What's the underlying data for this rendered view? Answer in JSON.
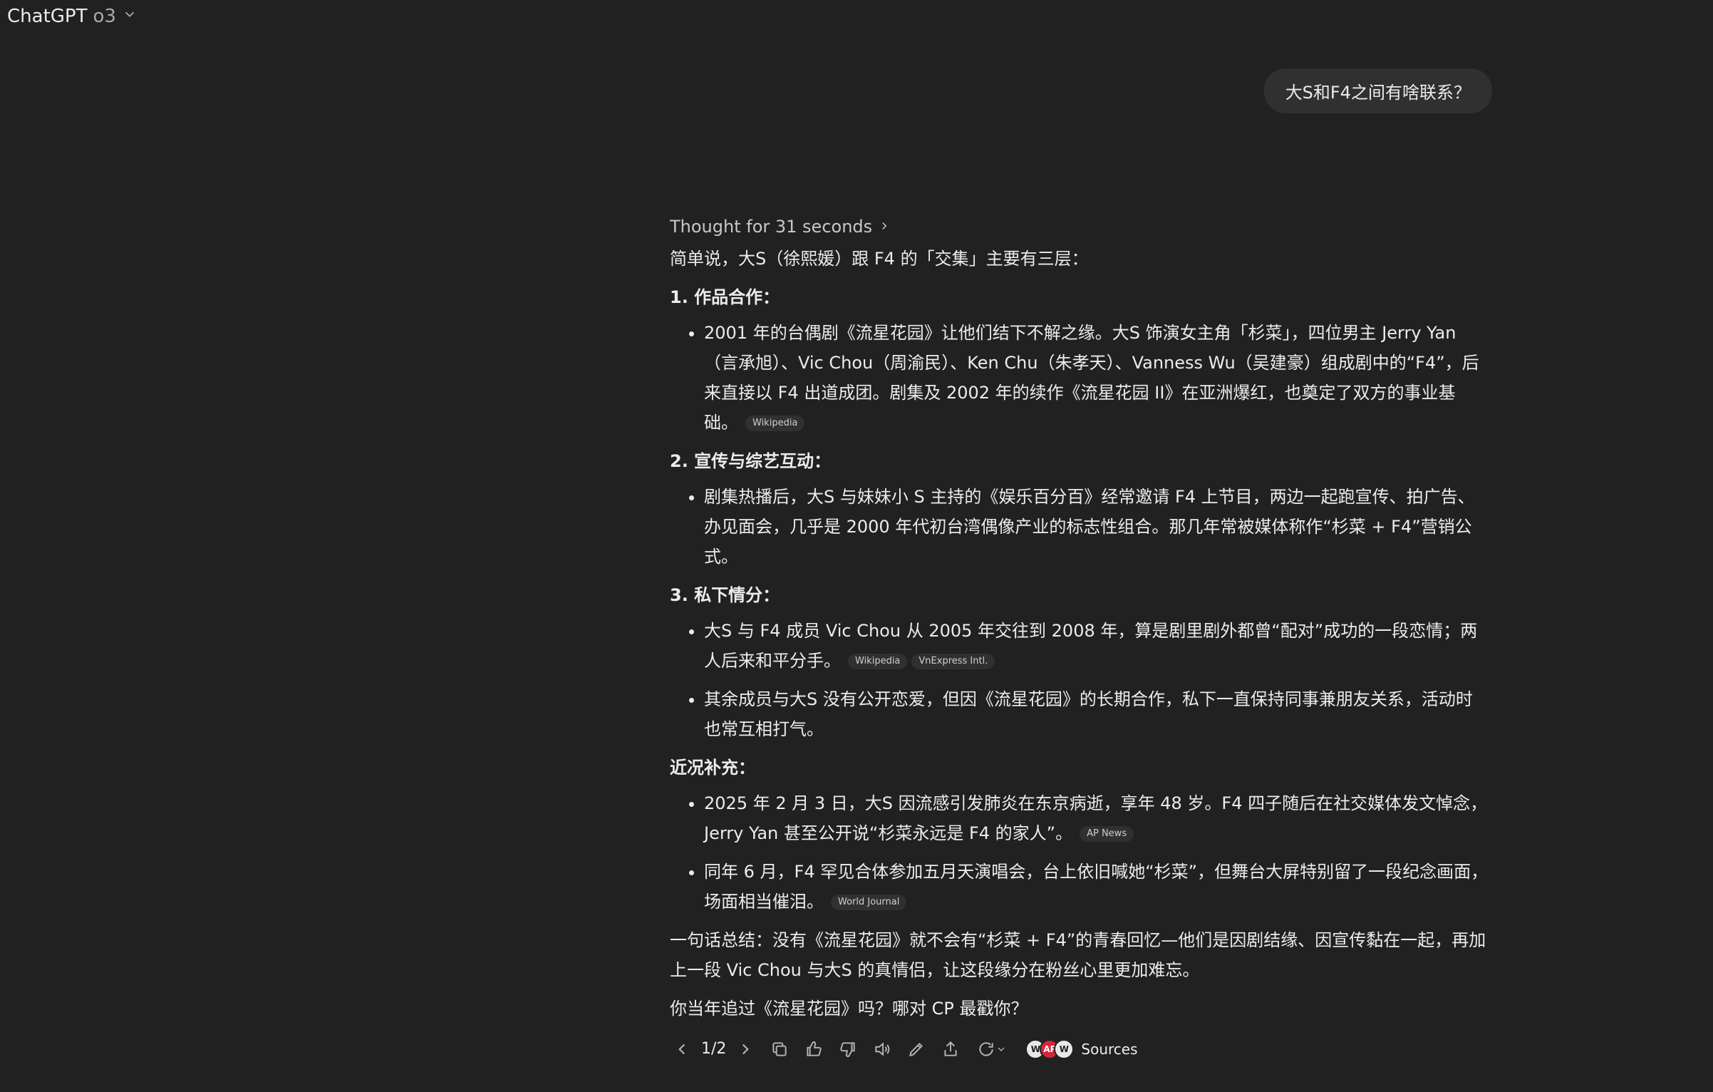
{
  "header": {
    "brand": "ChatGPT",
    "model": "o3"
  },
  "user_message": "大S和F4之间有啥联系？",
  "assistant": {
    "thought_label": "Thought for 31 seconds",
    "intro": "简单说，大S（徐熙媛）跟 F4 的「交集」主要有三层：",
    "sections": [
      {
        "heading": "1. 作品合作：",
        "bullets": [
          {
            "text": "2001 年的台偶剧《流星花园》让他们结下不解之缘。大S 饰演女主角「杉菜」，四位男主 Jerry Yan（言承旭）、Vic Chou（周渝民）、Ken Chu（朱孝天）、Vanness Wu（吴建豪）组成剧中的“F4”，后来直接以 F4 出道成团。剧集及 2002 年的续作《流星花园 II》在亚洲爆红，也奠定了双方的事业基础。",
            "cites": [
              "Wikipedia"
            ]
          }
        ]
      },
      {
        "heading": "2. 宣传与综艺互动：",
        "bullets": [
          {
            "text": "剧集热播后，大S 与妹妹小 S 主持的《娱乐百分百》经常邀请 F4 上节目，两边一起跑宣传、拍广告、办见面会，几乎是 2000 年代初台湾偶像产业的标志性组合。那几年常被媒体称作“杉菜 + F4”营销公式。",
            "cites": []
          }
        ]
      },
      {
        "heading": "3. 私下情分：",
        "bullets": [
          {
            "text": "大S 与 F4 成员 Vic Chou 从 2005 年交往到 2008 年，算是剧里剧外都曾“配对”成功的一段恋情；两人后来和平分手。",
            "cites": [
              "Wikipedia",
              "VnExpress Intl."
            ]
          },
          {
            "text": "其余成员与大S 没有公开恋爱，但因《流星花园》的长期合作，私下一直保持同事兼朋友关系，活动时也常互相打气。",
            "cites": []
          }
        ]
      },
      {
        "heading": "近况补充：",
        "bullets": [
          {
            "text": "2025 年 2 月 3 日，大S 因流感引发肺炎在东京病逝，享年 48 岁。F4 四子随后在社交媒体发文悼念，Jerry Yan 甚至公开说“杉菜永远是 F4 的家人”。",
            "cites": [
              "AP News"
            ]
          },
          {
            "text": "同年 6 月，F4 罕见合体参加五月天演唱会，台上依旧喊她“杉菜”，但舞台大屏特别留了一段纪念画面，场面相当催泪。",
            "cites": [
              "World Journal"
            ]
          }
        ]
      }
    ],
    "summary": "一句话总结：没有《流星花园》就不会有“杉菜 + F4”的青春回忆—他们是因剧结缘、因宣传黏在一起，再加上一段 Vic Chou 与大S 的真情侣，让这段缘分在粉丝心里更加难忘。",
    "question": "你当年追过《流星花园》吗？哪对 CP 最戳你？"
  },
  "actions": {
    "pager": "1/2",
    "sources_label": "Sources",
    "source_favicons": [
      "W",
      "AP",
      "W"
    ]
  }
}
